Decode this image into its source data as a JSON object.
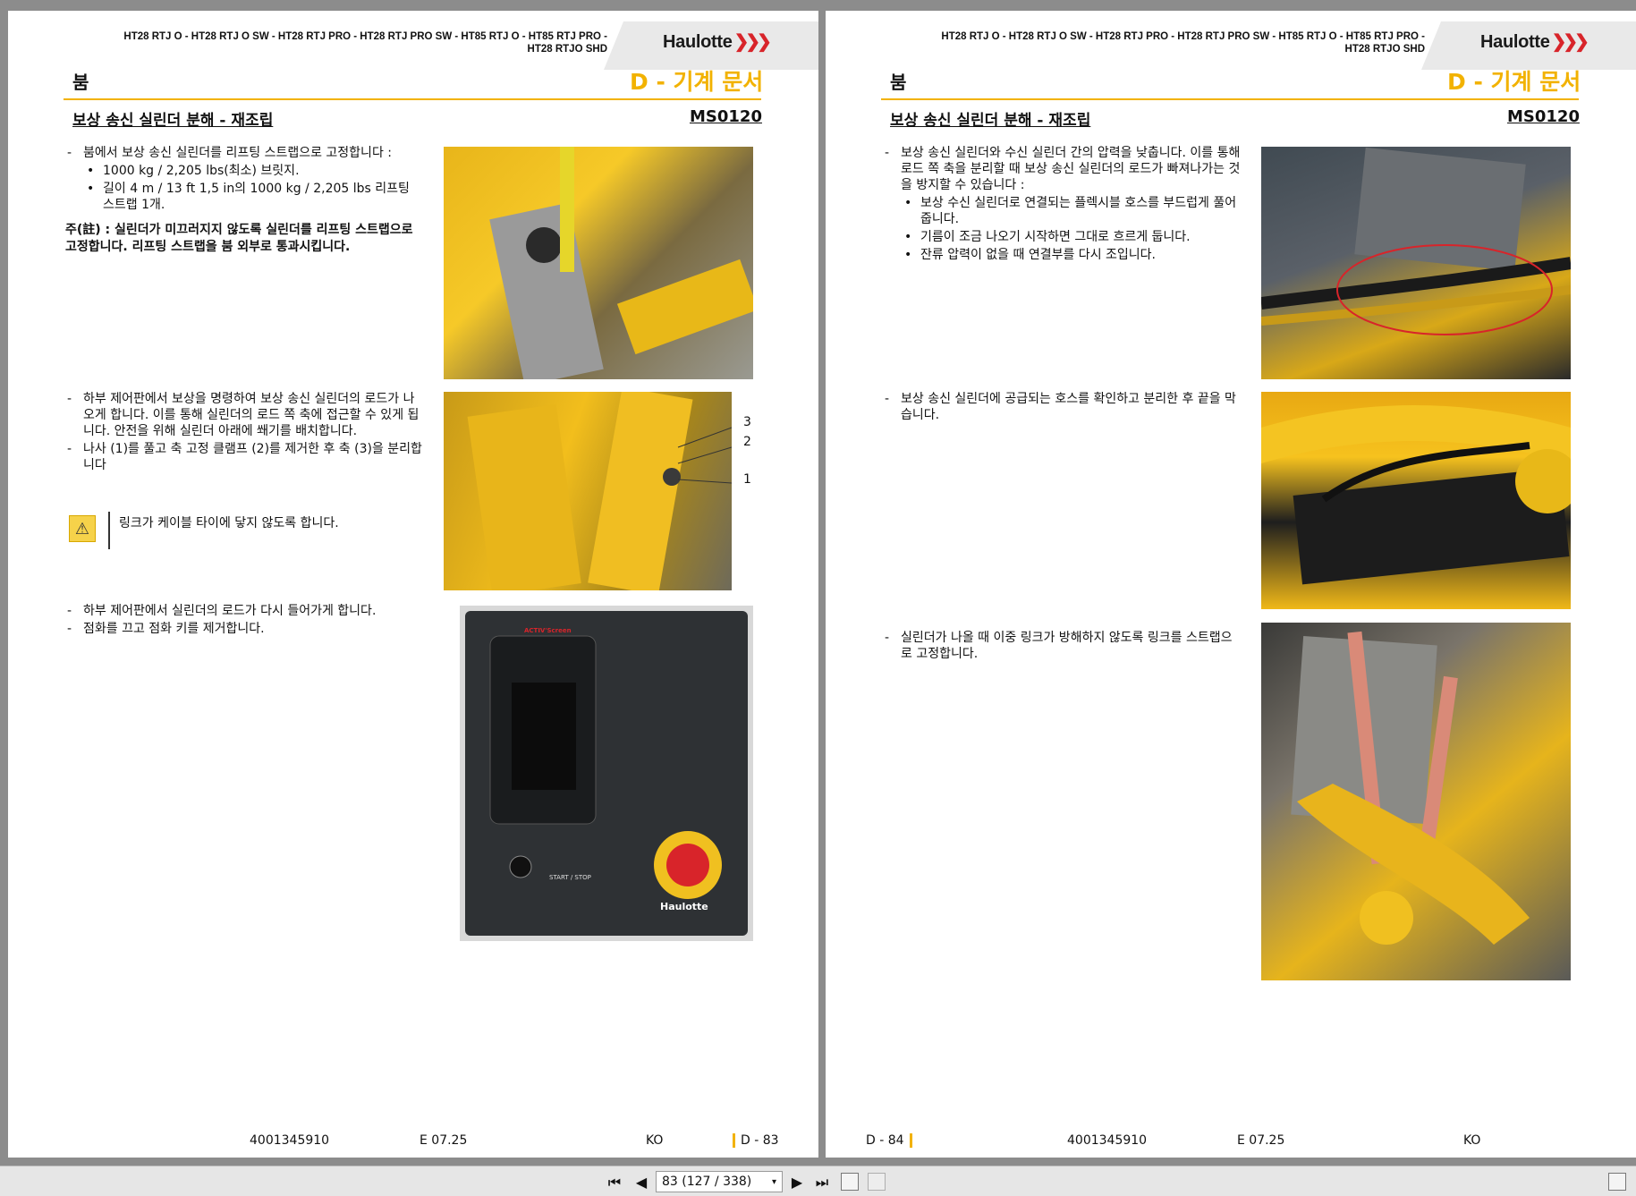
{
  "document": {
    "models_line1": "HT28 RTJ O - HT28 RTJ O SW - HT28 RTJ PRO - HT28 RTJ PRO SW - HT85 RTJ O - HT85 RTJ PRO -",
    "models_line2": "HT28 RTJO SHD",
    "brand": "Haulotte",
    "section": "붐",
    "chapter": "D - 기계 문서",
    "procedure": "보상 송신 실린더 분해 - 재조립",
    "code": "MS0120",
    "doc_number": "4001345910",
    "edition": "E 07.25",
    "language": "KO"
  },
  "left_page": {
    "page_number": "D - 83",
    "block1": {
      "step": "붐에서 보상 송신 실린더를 리프팅 스트랩으로 고정합니다 :",
      "sub1": "1000 kg / 2,205 lbs(최소) 브릿지.",
      "sub2": "길이 4 m / 13 ft 1,5 in의 1000 kg / 2,205 lbs 리프팅 스트랩 1개.",
      "note": "주(註) : 실린더가 미끄러지지 않도록 실린더를 리프팅 스트랩으로 고정합니다. 리프팅 스트랩을 붐 외부로 통과시킵니다."
    },
    "block2": {
      "step1": "하부 제어판에서 보상을 명령하여 보상 송신 실린더의 로드가 나오게 합니다. 이를 통해 실린더의 로드 쪽 축에 접근할 수 있게 됩니다. 안전을 위해 실린더 아래에 쐐기를 배치합니다.",
      "step2": "나사 (1)를 풀고 축 고정 클램프 (2)를 제거한 후 축 (3)을 분리합니다",
      "warning": "링크가 케이블 타이에 닿지 않도록 합니다.",
      "callout3": "3",
      "callout2": "2",
      "callout1": "1"
    },
    "block3": {
      "step1": "하부 제어판에서 실린더의 로드가 다시 들어가게 합니다.",
      "step2": "점화를 끄고 점화 키를 제거합니다.",
      "panel_brand": "Haulotte",
      "panel_screen": "ACTIV'Screen",
      "panel_start": "START / STOP"
    }
  },
  "right_page": {
    "page_number": "D - 84",
    "block1": {
      "step": "보상 송신 실린더와 수신 실린더 간의 압력을 낮춥니다. 이를 통해 로드 쪽 축을 분리할 때 보상 송신 실린더의 로드가 빠져나가는 것을 방지할 수 있습니다 :",
      "sub1": "보상 수신 실린더로 연결되는 플렉시블 호스를 부드럽게 풀어줍니다.",
      "sub2": "기름이 조금 나오기 시작하면 그대로 흐르게 둡니다.",
      "sub3": "잔류 압력이 없을 때 연결부를 다시 조입니다."
    },
    "block2": {
      "step": "보상 송신 실린더에 공급되는 호스를 확인하고 분리한 후 끝을 막습니다."
    },
    "block3": {
      "step": "실린더가 나올 때 이중 링크가 방해하지 않도록 링크를 스트랩으로 고정합니다."
    }
  },
  "toolbar": {
    "page_indicator": "83 (127 / 338)"
  },
  "colors": {
    "accent": "#f2b200",
    "brand_red": "#d8242a"
  }
}
